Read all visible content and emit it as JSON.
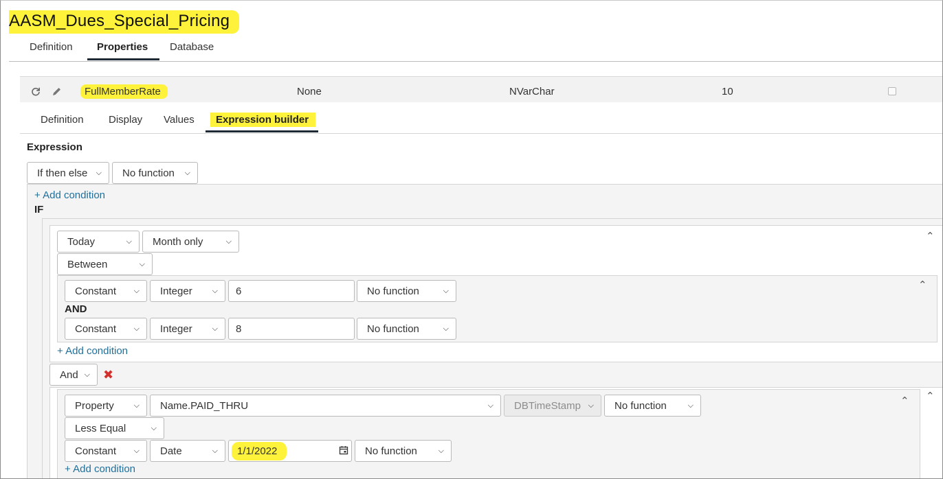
{
  "page": {
    "title": "AASM_Dues_Special_Pricing"
  },
  "main_tabs": [
    {
      "label": "Definition"
    },
    {
      "label": "Properties"
    },
    {
      "label": "Database"
    }
  ],
  "property_row": {
    "name": "FullMemberRate",
    "default_value": "None",
    "data_type": "NVarChar",
    "length": "10",
    "checked": false,
    "icons": [
      "refresh-icon",
      "pencil-icon"
    ]
  },
  "sub_tabs": [
    {
      "label": "Definition"
    },
    {
      "label": "Display"
    },
    {
      "label": "Values"
    },
    {
      "label": "Expression builder"
    }
  ],
  "expression": {
    "heading": "Expression",
    "type_select": "If then else",
    "function_select": "No function",
    "add_condition": "+ Add condition",
    "if_label": "IF",
    "condition1": {
      "left_source": "Today",
      "left_part": "Month only",
      "operator": "Between",
      "between": {
        "from": {
          "source": "Constant",
          "type": "Integer",
          "value": "6",
          "function": "No function"
        },
        "and_label": "AND",
        "to": {
          "source": "Constant",
          "type": "Integer",
          "value": "8",
          "function": "No function"
        }
      },
      "add_condition": "+ Add condition"
    },
    "joiner": "And",
    "condition2": {
      "left_source": "Property",
      "left_property": "Name.PAID_THRU",
      "left_datatype": "DBTimeStamp",
      "left_function": "No function",
      "operator": "Less Equal",
      "right_source": "Constant",
      "right_type": "Date",
      "right_value": "1/1/2022",
      "right_function": "No function",
      "add_condition": "+ Add condition"
    }
  },
  "colors": {
    "highlight": "#fff23a",
    "link": "#1f6f9a",
    "tab_underline": "#1e2a36",
    "remove": "#d0312d"
  }
}
